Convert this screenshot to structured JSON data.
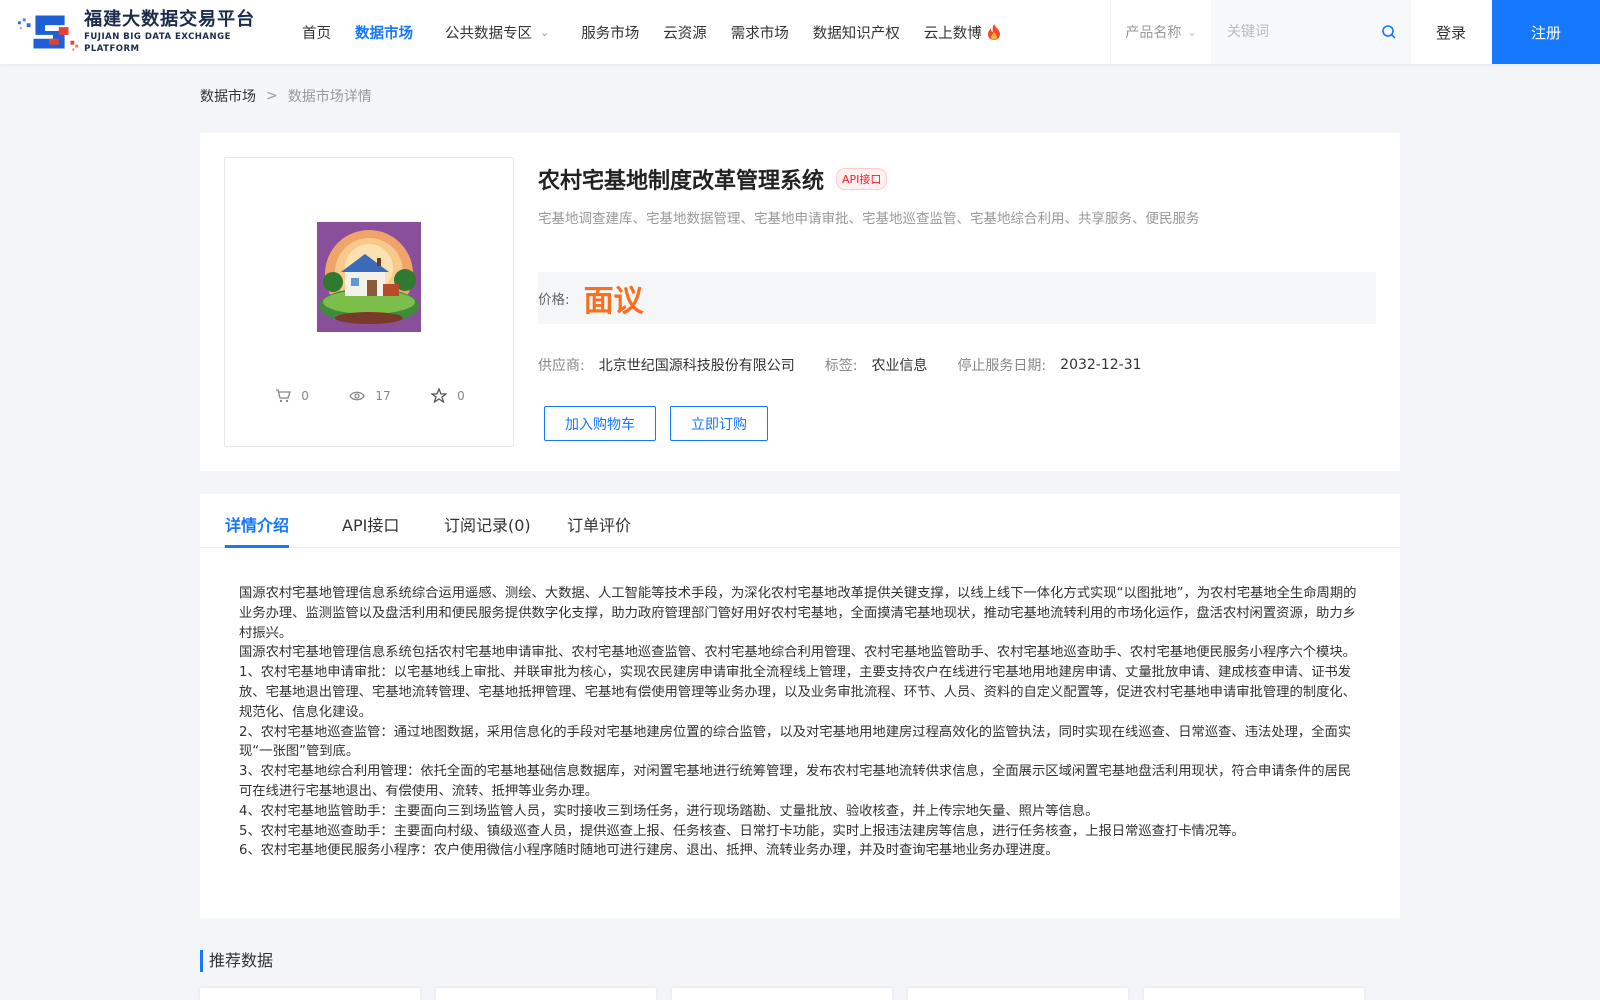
{
  "header": {
    "logo_cn": "福建大数据交易平台",
    "logo_en": "FUJIAN BIG DATA EXCHANGE  PLATFORM",
    "nav": [
      {
        "label": "首页"
      },
      {
        "label": "数据市场"
      },
      {
        "label": "公共数据专区"
      },
      {
        "label": "服务市场"
      },
      {
        "label": "云资源"
      },
      {
        "label": "需求市场"
      },
      {
        "label": "数据知识产权"
      },
      {
        "label": "云上数博"
      }
    ],
    "search_type": "产品名称",
    "search_placeholder": "关键词",
    "login": "登录",
    "register": "注册",
    "accent": "#1677ff"
  },
  "breadcrumb": {
    "root": "数据市场",
    "sep": ">",
    "current": "数据市场详情"
  },
  "product": {
    "title": "农村宅基地制度改革管理系统",
    "badge": "API接口",
    "subtitle": "宅基地调查建库、宅基地数据管理、宅基地申请审批、宅基地巡查监管、宅基地综合利用、共享服务、便民服务",
    "price_label": "价格:",
    "price_value": "面议",
    "price_color": "#fa6f1e",
    "supplier_label": "供应商:",
    "supplier": "北京世纪国源科技股份有限公司",
    "tag_label": "标签:",
    "tag": "农业信息",
    "stop_label": "停止服务日期:",
    "stop_date": "2032-12-31",
    "cart_count": "0",
    "view_count": "17",
    "fav_count": "0",
    "btn_cart": "加入购物车",
    "btn_buy": "立即订购"
  },
  "tabs": [
    {
      "label": "详情介绍"
    },
    {
      "label": "API接口"
    },
    {
      "label": "订阅记录(0)"
    },
    {
      "label": "订单评价"
    }
  ],
  "detail": {
    "paragraphs": [
      "国源农村宅基地管理信息系统综合运用遥感、测绘、大数据、人工智能等技术手段，为深化农村宅基地改革提供关键支撑，以线上线下一体化方式实现“以图批地”，为农村宅基地全生命周期的业务办理、监测监管以及盘活利用和便民服务提供数字化支撑，助力政府管理部门管好用好农村宅基地，全面摸清宅基地现状，推动宅基地流转利用的市场化运作，盘活农村闲置资源，助力乡村振兴。",
      "国源农村宅基地管理信息系统包括农村宅基地申请审批、农村宅基地巡查监管、农村宅基地综合利用管理、农村宅基地监管助手、农村宅基地巡查助手、农村宅基地便民服务小程序六个模块。",
      "1、农村宅基地申请审批：以宅基地线上审批、并联审批为核心，实现农民建房申请审批全流程线上管理，主要支持农户在线进行宅基地用地建房申请、丈量批放申请、建成核查申请、证书发放、宅基地退出管理、宅基地流转管理、宅基地抵押管理、宅基地有偿使用管理等业务办理，以及业务审批流程、环节、人员、资料的自定义配置等，促进农村宅基地申请审批管理的制度化、规范化、信息化建设。",
      "2、农村宅基地巡查监管：通过地图数据，采用信息化的手段对宅基地建房位置的综合监管，以及对宅基地用地建房过程高效化的监管执法，同时实现在线巡查、日常巡查、违法处理，全面实现“一张图”管到底。",
      "3、农村宅基地综合利用管理：依托全面的宅基地基础信息数据库，对闲置宅基地进行统筹管理，发布农村宅基地流转供求信息，全面展示区域闲置宅基地盘活利用现状，符合申请条件的居民可在线进行宅基地退出、有偿使用、流转、抵押等业务办理。",
      "4、农村宅基地监管助手：主要面向三到场监管人员，实时接收三到场任务，进行现场踏勘、丈量批放、验收核查，并上传宗地矢量、照片等信息。",
      "5、农村宅基地巡查助手：主要面向村级、镇级巡查人员，提供巡查上报、任务核查、日常打卡功能，实时上报违法建房等信息，进行任务核查，上报日常巡查打卡情况等。",
      "6、农村宅基地便民服务小程序：农户使用微信小程序随时随地可进行建房、退出、抵押、流转业务办理，并及时查询宅基地业务办理进度。"
    ]
  },
  "recommend": {
    "title": "推荐数据"
  }
}
